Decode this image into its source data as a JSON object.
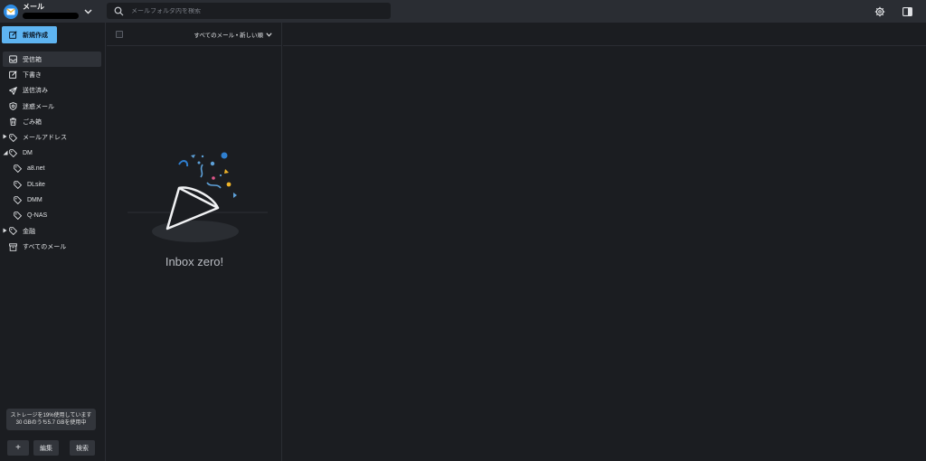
{
  "app": {
    "title": "メール"
  },
  "search": {
    "placeholder": "メールフォルダ内を検索"
  },
  "compose": {
    "label": "新規作成"
  },
  "nav": [
    {
      "label": "受信箱",
      "icon": "inbox-icon",
      "active": true
    },
    {
      "label": "下書き",
      "icon": "draft-icon"
    },
    {
      "label": "送信済み",
      "icon": "send-icon"
    },
    {
      "label": "迷惑メール",
      "icon": "shield-icon"
    },
    {
      "label": "ごみ箱",
      "icon": "trash-icon"
    },
    {
      "label": "メールアドレス",
      "icon": "tag-icon",
      "expandable": "collapsed"
    },
    {
      "label": "DM",
      "icon": "tag-icon",
      "expandable": "expanded"
    },
    {
      "label": "a8.net",
      "icon": "tag-icon",
      "sub": true
    },
    {
      "label": "DLsite",
      "icon": "tag-icon",
      "sub": true
    },
    {
      "label": "DMM",
      "icon": "tag-icon",
      "sub": true
    },
    {
      "label": "Q-NAS",
      "icon": "tag-icon",
      "sub": true
    },
    {
      "label": "金融",
      "icon": "tag-icon",
      "expandable": "collapsed"
    },
    {
      "label": "すべてのメール",
      "icon": "archive-icon"
    }
  ],
  "storage": {
    "line1": "ストレージを19%使用しています",
    "line2": "30 GBのうち5.7 GBを使用中"
  },
  "footer": {
    "add_label": "+",
    "edit_label": "編集",
    "search_label": "検索"
  },
  "list": {
    "sort_label": "すべてのメール • 新しい順",
    "empty_text": "Inbox zero!"
  },
  "colors": {
    "accent": "#5eb4f1",
    "topbar": "#2a2d33",
    "background": "#1b1d21"
  }
}
